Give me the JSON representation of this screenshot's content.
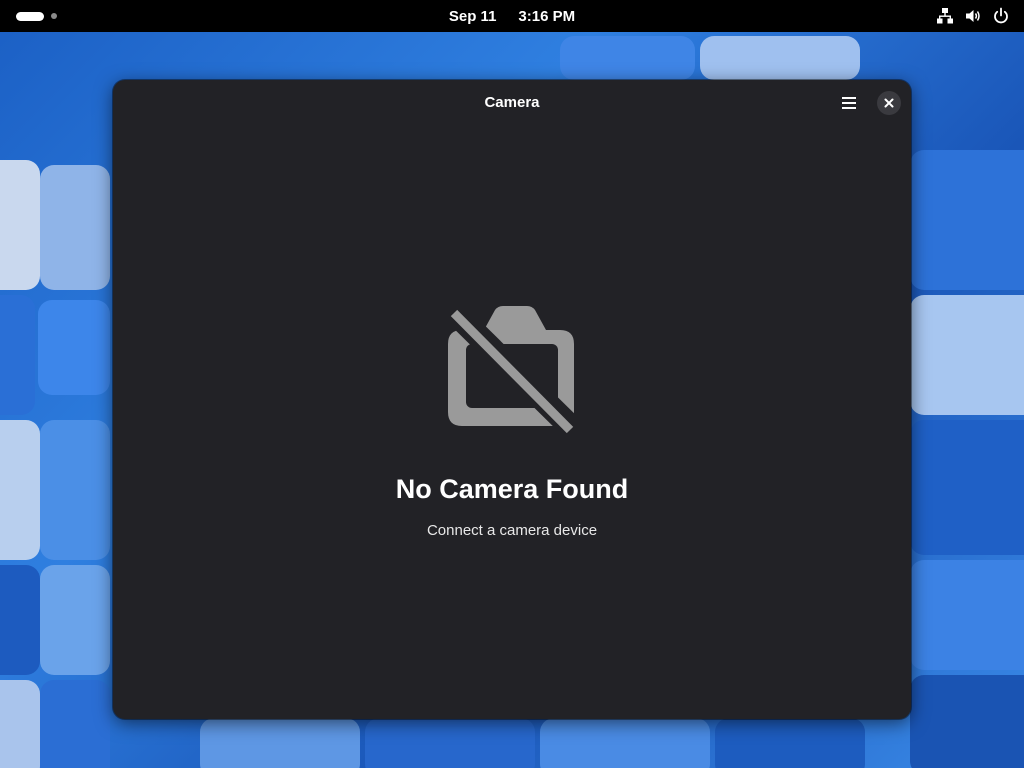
{
  "topbar": {
    "date": "Sep 11",
    "time": "3:16 PM",
    "icons": [
      "activities-workspace-indicator",
      "network-wired-icon",
      "volume-icon",
      "power-icon"
    ]
  },
  "window": {
    "title": "Camera",
    "menu_icon": "hamburger-menu-icon",
    "close_icon": "close-icon"
  },
  "status": {
    "icon": "camera-disabled-icon",
    "title": "No Camera Found",
    "description": "Connect a camera device"
  },
  "colors": {
    "window_bg": "#222226",
    "topbar_bg": "#000000",
    "icon_gray": "#9a9a9a",
    "desktop_blue": "#1f66d0"
  }
}
